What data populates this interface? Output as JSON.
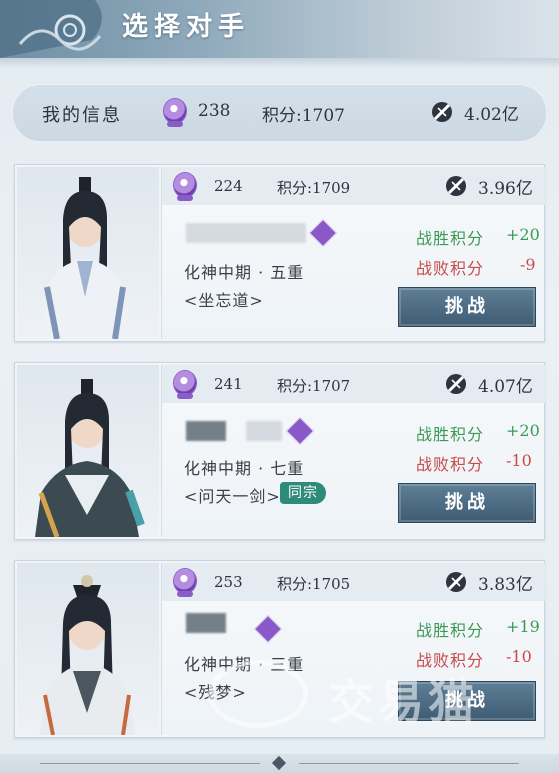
{
  "header": {
    "title": "选择对手"
  },
  "my_info": {
    "label": "我的信息",
    "rank": "238",
    "score": "积分:1707",
    "power": "4.02亿"
  },
  "opponents": [
    {
      "rank": "224",
      "score": "积分:1709",
      "power": "3.96亿",
      "realm": "化神中期 · 五重",
      "sect": "<坐忘道>",
      "same_sect": "",
      "win_label": "战胜积分",
      "win_value": "+20",
      "lose_label": "战败积分",
      "lose_value": "-9",
      "button": "挑战"
    },
    {
      "rank": "241",
      "score": "积分:1707",
      "power": "4.07亿",
      "realm": "化神中期 · 七重",
      "sect": "<问天一剑>",
      "same_sect": "同宗",
      "win_label": "战胜积分",
      "win_value": "+20",
      "lose_label": "战败积分",
      "lose_value": "-10",
      "button": "挑战"
    },
    {
      "rank": "253",
      "score": "积分:1705",
      "power": "3.83亿",
      "realm": "化神中期 · 三重",
      "sect": "<残梦>",
      "same_sect": "",
      "win_label": "战胜积分",
      "win_value": "+19",
      "lose_label": "战败积分",
      "lose_value": "-10",
      "button": "挑战"
    }
  ],
  "watermark": {
    "text": "交易猫"
  },
  "icons": {
    "rank": "purple-moon-rank-icon",
    "power": "sword-power-icon",
    "sect_badge": "purple-diamond-sect-icon"
  },
  "colors": {
    "win": "#3a9a55",
    "lose": "#c84a4a",
    "button": "#4a6880",
    "same_sect": "#2e8a79",
    "rank_badge": "#8a59c8"
  }
}
